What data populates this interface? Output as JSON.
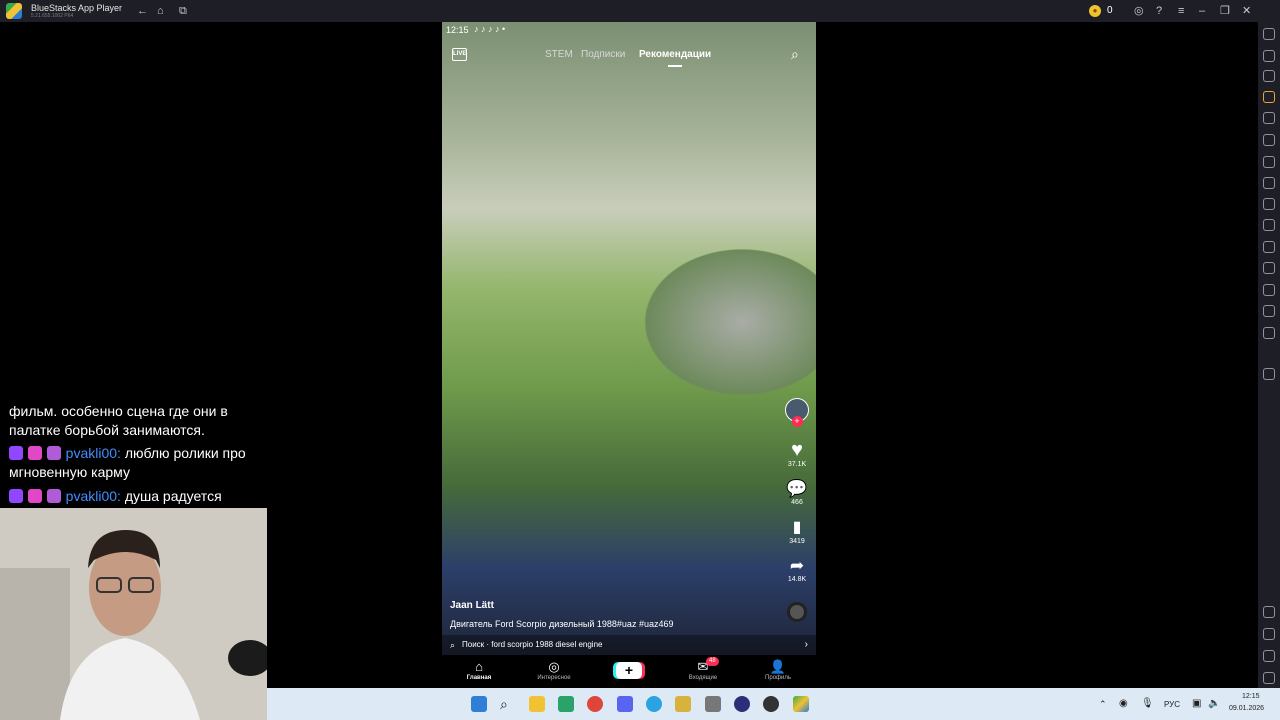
{
  "titlebar": {
    "app_name": "BlueStacks App Player",
    "version": "5.21.655.1002 P64",
    "coin_count": "0",
    "icons": [
      "back-icon",
      "home-icon",
      "multi-instance-icon",
      "coin-icon",
      "account-icon",
      "help-icon",
      "menu-icon",
      "minimize-icon",
      "restore-icon",
      "close-icon"
    ]
  },
  "chat": {
    "lines": [
      {
        "text": "фильм. особенно сцена где они в палатке борьбой занимаются."
      },
      {
        "user": "pvakli00:",
        "text": " люблю ролики про мгновенную карму"
      },
      {
        "user": "pvakli00:",
        "text": " душа радуется"
      }
    ]
  },
  "phone": {
    "status_time": "12:15",
    "live_label": "LIVE",
    "tabs": [
      "STEM",
      "Подписки",
      "Рекомендации"
    ],
    "likes": "37.1K",
    "comments": "466",
    "saves": "3419",
    "shares": "14.8K",
    "author": "Jaan Lätt",
    "caption": "Двигатель Ford Scorpio дизельный 1988#uaz #uaz469",
    "search_text": "Поиск · ford scorpio 1988 diesel engine",
    "nav": {
      "home": "Главная",
      "discover": "Интересное",
      "inbox": "Входящие",
      "inbox_badge": "48",
      "profile": "Профиль",
      "create_label": "+"
    }
  },
  "taskbar": {
    "language": "РУС",
    "time": "12:15",
    "date": "09.01.2026"
  },
  "colors": {
    "accent_pink": "#fe2c55",
    "accent_cyan": "#25f4ee",
    "chat_username": "#3f8fff",
    "bluestacks_bar": "#1e1f26"
  }
}
